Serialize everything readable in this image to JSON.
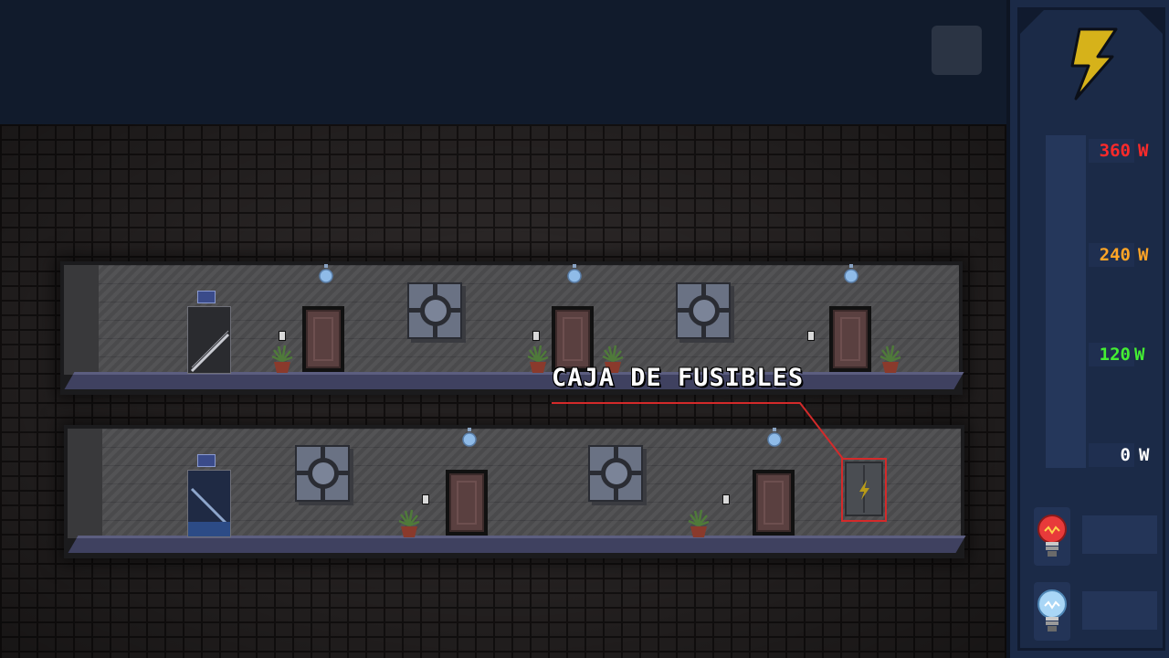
{
  "callout": {
    "label": "CAJA DE FUSIBLES",
    "highlight_color": "#d42a2a"
  },
  "power_meter": {
    "unit": "W",
    "levels": [
      {
        "value": "360",
        "color": "#ff2a2a"
      },
      {
        "value": "240",
        "color": "#ffa526"
      },
      {
        "value": "120",
        "color": "#44ee33"
      },
      {
        "value": "0",
        "color": "#ffffff"
      }
    ],
    "current_fill": 0
  },
  "icons": {
    "power": "lightning-bolt-icon",
    "menu": "menu-button",
    "hot_bulb": "red-bulb-icon",
    "cold_bulb": "blue-bulb-icon"
  },
  "colors": {
    "panel_bg": "#1b2a47",
    "bolt": "#d6b21a"
  }
}
